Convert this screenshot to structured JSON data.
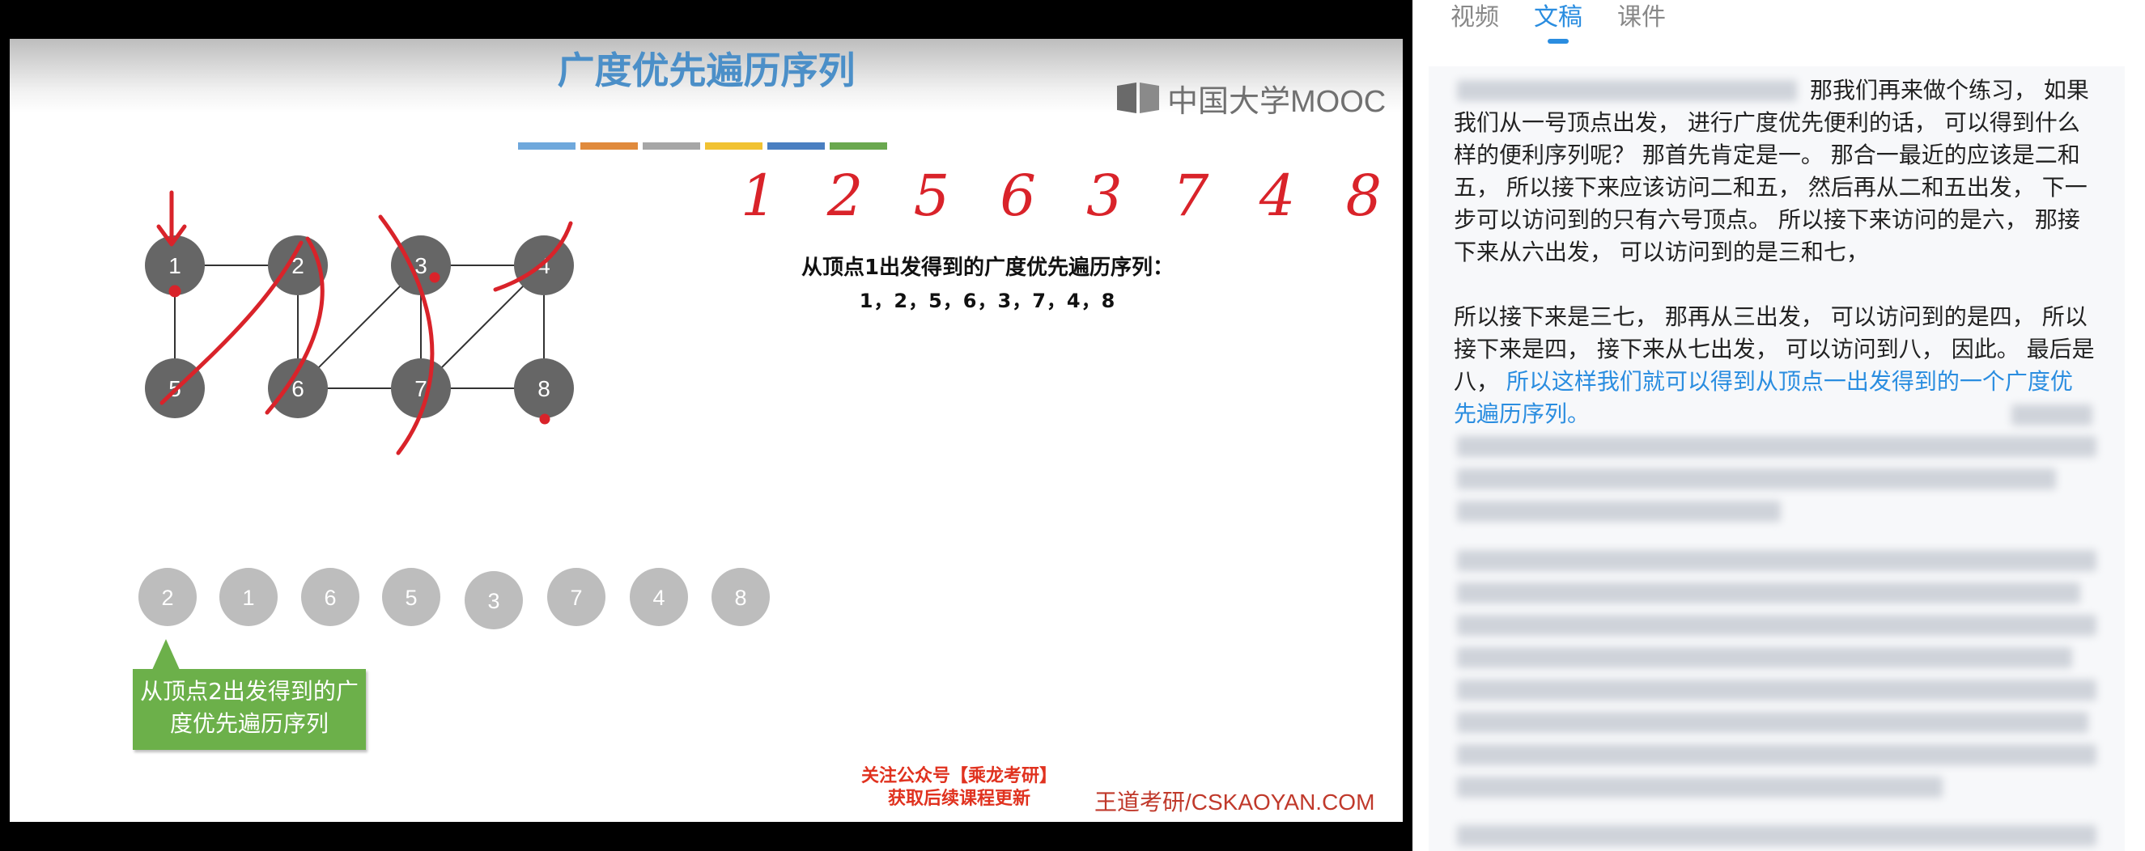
{
  "slide": {
    "title": "广度优先遍历序列",
    "logo": "中国大学MOOC",
    "color_strip": [
      "#6fa8dc",
      "#e08a3c",
      "#a6a6a6",
      "#f1c232",
      "#4a7fc1",
      "#6aa84f"
    ],
    "graph_nodes": [
      "1",
      "2",
      "3",
      "4",
      "5",
      "6",
      "7",
      "8"
    ],
    "handwritten_sequence": "1 2 5 6 3 7 4 8",
    "bfs_label": "从顶点1出发得到的广度优先遍历序列：",
    "bfs_value": "1，2，5，6，3，7，4，8",
    "queue_items": [
      "2",
      "1",
      "6",
      "5",
      "3",
      "7",
      "4",
      "8"
    ],
    "callout": "从顶点2出发得到的广度优先遍历序列",
    "footer_promo_line1": "关注公众号【乘龙考研】",
    "footer_promo_line2": "获取后续课程更新",
    "footer_brand": "王道考研/CSKAOYAN.COM"
  },
  "panel": {
    "tabs": [
      "视频",
      "文稿",
      "课件"
    ],
    "active_tab": "文稿",
    "transcript": {
      "p1": "那我们再来做个练习， 如果我们从一号顶点出发， 进行广度优先便利的话， 可以得到什么样的便利序列呢？ 那首先肯定是一。 那合一最近的应该是二和五， 所以接下来应该访问二和五， 然后再从二和五出发， 下一步可以访问到的只有六号顶点。 所以接下来访问的是六， 那接下来从六出发， 可以访问到的是三和七，",
      "p2_plain": "所以接下来是三七， 那再从三出发， 可以访问到的是四， 所以接下来是四， 接下来从七出发， 可以访问到八， 因此。 最后是八，",
      "p2_highlight": " 所以这样我们就可以得到从顶点一出发得到的一个广度优先遍历序列。"
    },
    "accent_color": "#2a8de0"
  }
}
